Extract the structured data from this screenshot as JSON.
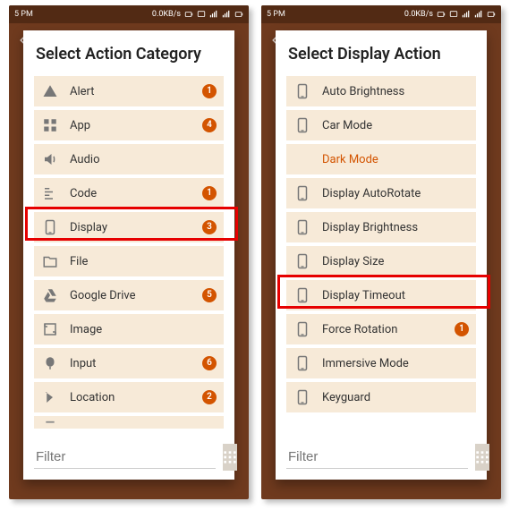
{
  "statusbar": {
    "time": "5 PM",
    "net_rate": "0.0KB/s"
  },
  "filter": {
    "placeholder": "Filter"
  },
  "colors": {
    "accent": "#d35400",
    "row_bg": "#f7ead8",
    "highlight": "#e60000"
  },
  "panels": [
    {
      "title": "Select Action Category",
      "highlight_index": 4,
      "has_partial_last": true,
      "items": [
        {
          "icon": "alert",
          "label": "Alert",
          "badge": 1
        },
        {
          "icon": "app",
          "label": "App",
          "badge": 4
        },
        {
          "icon": "audio",
          "label": "Audio",
          "badge": null
        },
        {
          "icon": "code",
          "label": "Code",
          "badge": 1
        },
        {
          "icon": "display",
          "label": "Display",
          "badge": 3
        },
        {
          "icon": "file",
          "label": "File",
          "badge": null
        },
        {
          "icon": "gdrive",
          "label": "Google Drive",
          "badge": 5
        },
        {
          "icon": "image",
          "label": "Image",
          "badge": null
        },
        {
          "icon": "input",
          "label": "Input",
          "badge": 6
        },
        {
          "icon": "location",
          "label": "Location",
          "badge": 2
        }
      ]
    },
    {
      "title": "Select Display Action",
      "highlight_index": 6,
      "has_partial_last": false,
      "items": [
        {
          "icon": "display",
          "label": "Auto Brightness",
          "badge": null
        },
        {
          "icon": "display",
          "label": "Car Mode",
          "badge": null
        },
        {
          "icon": "display",
          "label": "Dark Mode",
          "badge": null,
          "special": true
        },
        {
          "icon": "display",
          "label": "Display AutoRotate",
          "badge": null
        },
        {
          "icon": "display",
          "label": "Display Brightness",
          "badge": null
        },
        {
          "icon": "display",
          "label": "Display Size",
          "badge": null
        },
        {
          "icon": "display",
          "label": "Display Timeout",
          "badge": null
        },
        {
          "icon": "display",
          "label": "Force Rotation",
          "badge": 1
        },
        {
          "icon": "display",
          "label": "Immersive Mode",
          "badge": null
        },
        {
          "icon": "display",
          "label": "Keyguard",
          "badge": null
        }
      ]
    }
  ]
}
